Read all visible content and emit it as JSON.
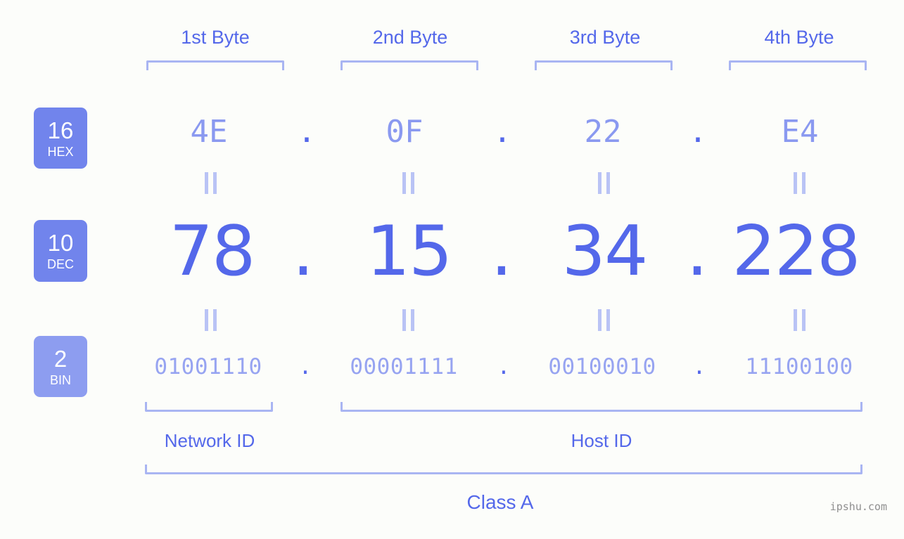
{
  "page": {
    "background_color": "#fcfdfa",
    "accent_color": "#5468ea",
    "accent_light_color": "#8a99f0",
    "bracket_color": "#a9b5f2",
    "badge_color": "#7184ec",
    "badge_light_color": "#8d9df0",
    "watermark": "ipshu.com"
  },
  "byte_headers": [
    {
      "label": "1st Byte"
    },
    {
      "label": "2nd Byte"
    },
    {
      "label": "3rd Byte"
    },
    {
      "label": "4th Byte"
    }
  ],
  "radix_badges": [
    {
      "number": "16",
      "abbr": "HEX"
    },
    {
      "number": "10",
      "abbr": "DEC"
    },
    {
      "number": "2",
      "abbr": "BIN"
    }
  ],
  "separators": {
    "dot": "."
  },
  "equivalence_symbol": "=",
  "rows": {
    "hex": {
      "radix": "16",
      "radix_name": "HEX",
      "octets": [
        "4E",
        "0F",
        "22",
        "E4"
      ],
      "full": "4E.0F.22.E4"
    },
    "dec": {
      "radix": "10",
      "radix_name": "DEC",
      "octets": [
        "78",
        "15",
        "34",
        "228"
      ],
      "full": "78.15.34.228"
    },
    "bin": {
      "radix": "2",
      "radix_name": "BIN",
      "octets": [
        "01001110",
        "00001111",
        "00100010",
        "11100100"
      ],
      "full": "01001110.00001111.00100010.11100100"
    }
  },
  "id_sections": [
    {
      "label": "Network ID"
    },
    {
      "label": "Host ID"
    }
  ],
  "class": {
    "label": "Class A"
  }
}
